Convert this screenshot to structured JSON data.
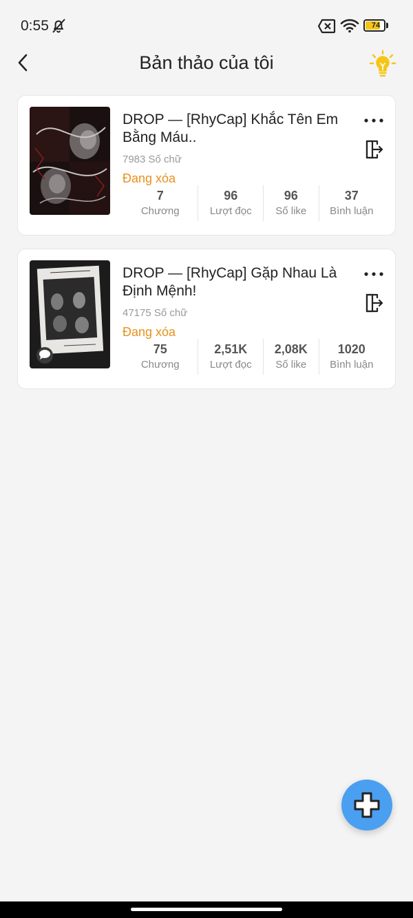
{
  "status_bar": {
    "time": "0:55",
    "battery_level": "74",
    "battery_fraction": 0.74,
    "icons": [
      "bell-off-icon",
      "sim-off-icon",
      "wifi-icon",
      "battery-icon"
    ]
  },
  "header": {
    "title": "Bản thảo của tôi",
    "icons": [
      "back-arrow-icon",
      "lightbulb-icon"
    ]
  },
  "drafts": [
    {
      "title": "DROP — [RhyCap] Khắc Tên Em Bằng Máu..",
      "word_count": "7983 Số chữ",
      "status": "Đang xóa",
      "stats": [
        {
          "value": "7",
          "label": "Chương"
        },
        {
          "value": "96",
          "label": "Lượt đọc"
        },
        {
          "value": "96",
          "label": "Số like"
        },
        {
          "value": "37",
          "label": "Bình luận"
        }
      ]
    },
    {
      "title": "DROP — [RhyCap] Gặp Nhau Là Định Mệnh!",
      "word_count": "47175 Số chữ",
      "status": "Đang xóa",
      "stats": [
        {
          "value": "75",
          "label": "Chương"
        },
        {
          "value": "2,51K",
          "label": "Lượt đọc"
        },
        {
          "value": "2,08K",
          "label": "Số like"
        },
        {
          "value": "1020",
          "label": "Bình luận"
        }
      ]
    }
  ],
  "colors": {
    "accent": "#4a9ff0",
    "status_orange": "#e8911c",
    "bulb_yellow": "#f5c518",
    "background": "#f4f4f4"
  },
  "fab": {
    "icon": "plus-icon"
  }
}
